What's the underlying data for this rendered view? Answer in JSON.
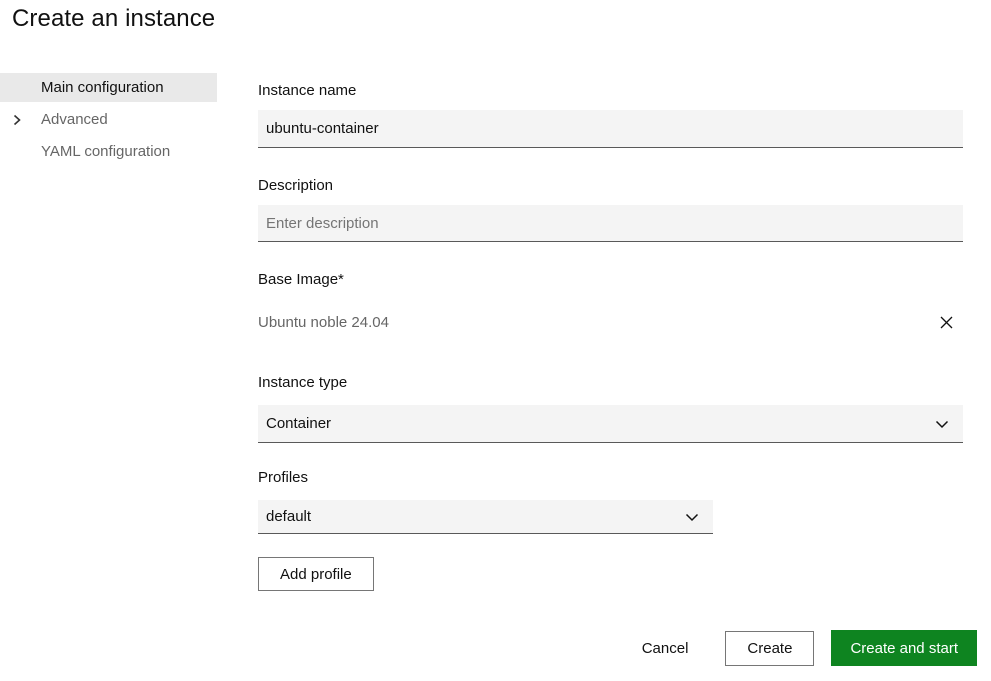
{
  "page": {
    "title": "Create an instance"
  },
  "sidebar": {
    "items": [
      {
        "label": "Main configuration",
        "active": true
      },
      {
        "label": "Advanced",
        "expandable": true
      },
      {
        "label": "YAML configuration",
        "active": false
      }
    ]
  },
  "form": {
    "instance_name": {
      "label": "Instance name",
      "value": "ubuntu-container"
    },
    "description": {
      "label": "Description",
      "placeholder": "Enter description"
    },
    "base_image": {
      "label": "Base Image*",
      "value": "Ubuntu noble 24.04"
    },
    "instance_type": {
      "label": "Instance type",
      "value": "Container"
    },
    "profiles": {
      "label": "Profiles",
      "value": "default",
      "add_button_label": "Add profile"
    }
  },
  "footer": {
    "cancel_label": "Cancel",
    "create_label": "Create",
    "create_and_start_label": "Create and start"
  },
  "icons": [
    "chevron-right-icon",
    "chevron-down-icon",
    "close-icon"
  ],
  "colors": {
    "positive_button": "#0e8420",
    "input_background": "#f4f4f4",
    "input_underline": "#595959",
    "sidebar_active_background": "#e9e9e9",
    "muted_text": "#666666",
    "text": "#111111"
  }
}
